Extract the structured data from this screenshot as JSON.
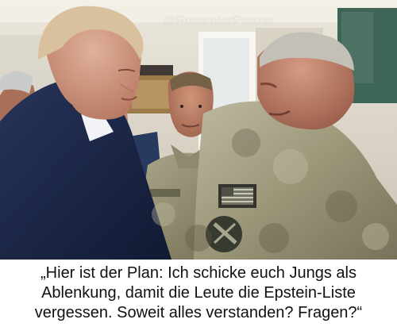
{
  "photo": {
    "watermark": "@RosaroterPanzer",
    "colors": {
      "wall": "#ddd7cb",
      "suit": "#1a2440",
      "camouflage": "#8f8a6d",
      "skin": "#d59b7e",
      "cabinet": "#9d7b49",
      "green_door": "#3f6557"
    }
  },
  "caption": {
    "line1": "„Hier ist der Plan: Ich schicke euch Jungs als",
    "line2": "Ablenkung, damit die Leute die Epstein-Liste",
    "line3": "vergessen. Soweit alles verstanden? Fragen?“"
  }
}
